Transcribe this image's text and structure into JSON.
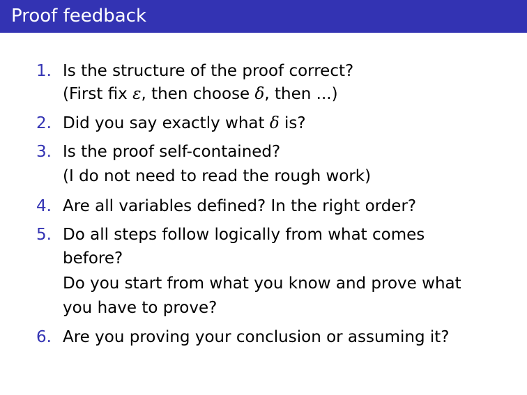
{
  "header": {
    "title": "Proof feedback"
  },
  "colors": {
    "accent": "#3333b3",
    "text": "#000000",
    "background": "#ffffff"
  },
  "items": [
    {
      "number": "1.",
      "lines": [
        "Is the structure of the proof correct?",
        {
          "parts": [
            "(First fix ",
            "ε",
            ", then choose ",
            "δ",
            ", then ...)"
          ]
        }
      ]
    },
    {
      "number": "2.",
      "lines": [
        {
          "parts": [
            "Did you say exactly what ",
            "δ",
            " is?"
          ]
        }
      ]
    },
    {
      "number": "3.",
      "lines": [
        "Is the proof self-contained?",
        "(I do not need to read the rough work)"
      ]
    },
    {
      "number": "4.",
      "lines": [
        "Are all variables defined? In the right order?"
      ]
    },
    {
      "number": "5.",
      "lines": [
        "Do all steps follow logically from what comes",
        "before?",
        "Do you start from what you know and prove what",
        "you have to prove?"
      ]
    },
    {
      "number": "6.",
      "lines": [
        "Are you proving your conclusion or assuming it?"
      ]
    }
  ]
}
